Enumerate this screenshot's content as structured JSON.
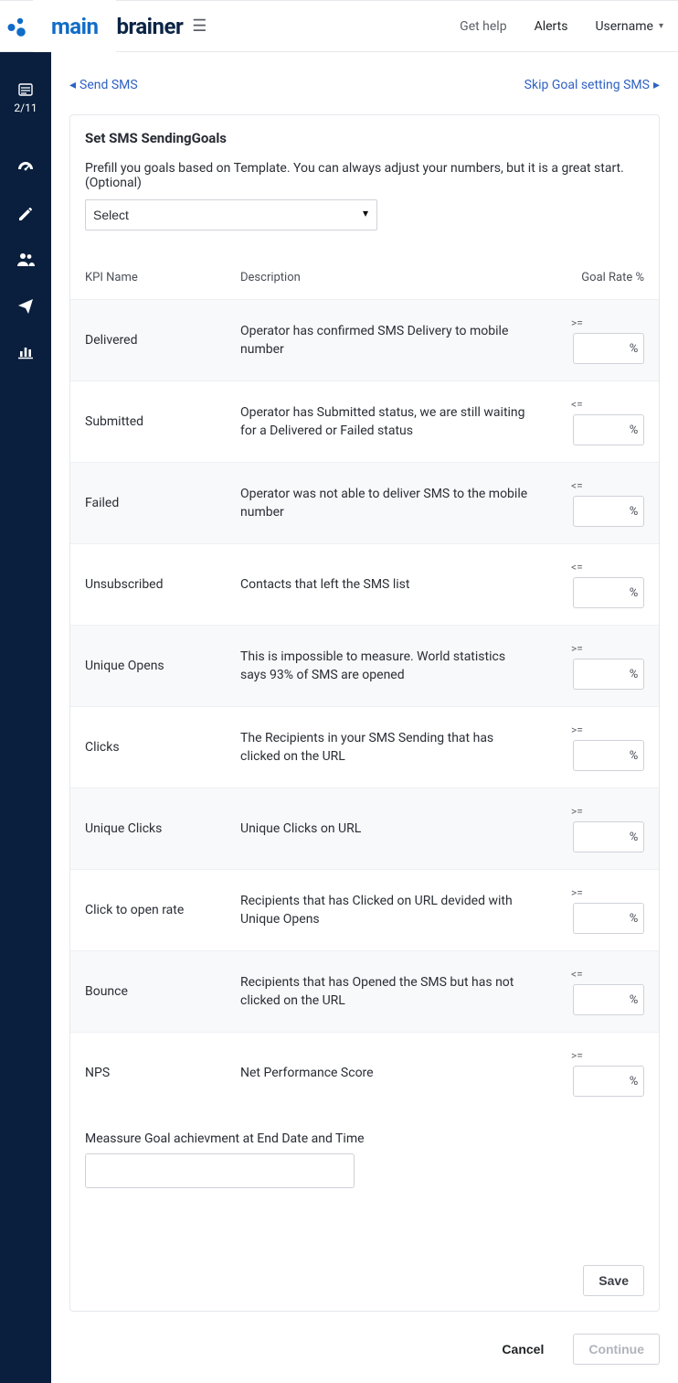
{
  "header": {
    "logo_main": "main",
    "logo_brainer": "brainer",
    "get_help": "Get help",
    "alerts": "Alerts",
    "username": "Username"
  },
  "sidebar": {
    "step": "2/11",
    "icons": [
      {
        "name": "dashboard-icon"
      },
      {
        "name": "edit-icon"
      },
      {
        "name": "audience-icon"
      },
      {
        "name": "send-icon"
      },
      {
        "name": "reports-icon"
      }
    ]
  },
  "nav": {
    "back": "Send SMS",
    "skip": "Skip Goal setting SMS"
  },
  "card": {
    "title": "Set SMS SendingGoals",
    "prefill_text": "Prefill you goals based on Template. You can always adjust your numbers, but it is a great start.(Optional)",
    "select_placeholder": "Select",
    "measure_label": "Meassure Goal achievment at End Date and Time",
    "save": "Save"
  },
  "table": {
    "col_name": "KPI Name",
    "col_desc": "Description",
    "col_rate": "Goal Rate %",
    "rows": [
      {
        "name": "Delivered",
        "desc": "Operator has confirmed SMS Delivery to mobile number",
        "op": ">=",
        "alt": true
      },
      {
        "name": "Submitted",
        "desc": "Operator has Submitted status, we are still waiting for a Delivered or Failed status",
        "op": "<=",
        "alt": false
      },
      {
        "name": "Failed",
        "desc": "Operator was not able to deliver SMS to the mobile number",
        "op": "<=",
        "alt": true
      },
      {
        "name": "Unsubscribed",
        "desc": "Contacts that left the SMS list",
        "op": "<=",
        "alt": false
      },
      {
        "name": "Unique Opens",
        "desc": "This is impossible to measure. World statistics says 93% of SMS are opened",
        "op": ">=",
        "alt": true
      },
      {
        "name": "Clicks",
        "desc": "The Recipients in your SMS Sending that has clicked on the URL",
        "op": ">=",
        "alt": false
      },
      {
        "name": "Unique Clicks",
        "desc": "Unique Clicks on URL",
        "op": ">=",
        "alt": true
      },
      {
        "name": "Click to open rate",
        "desc": "Recipients that has Clicked on URL devided with Unique Opens",
        "op": ">=",
        "alt": false
      },
      {
        "name": "Bounce",
        "desc": "Recipients that has Opened the SMS but has not clicked on the URL",
        "op": "<=",
        "alt": true
      },
      {
        "name": "NPS",
        "desc": "Net Performance Score",
        "op": ">=",
        "alt": false
      }
    ]
  },
  "footer": {
    "cancel": "Cancel",
    "continue": "Continue"
  }
}
